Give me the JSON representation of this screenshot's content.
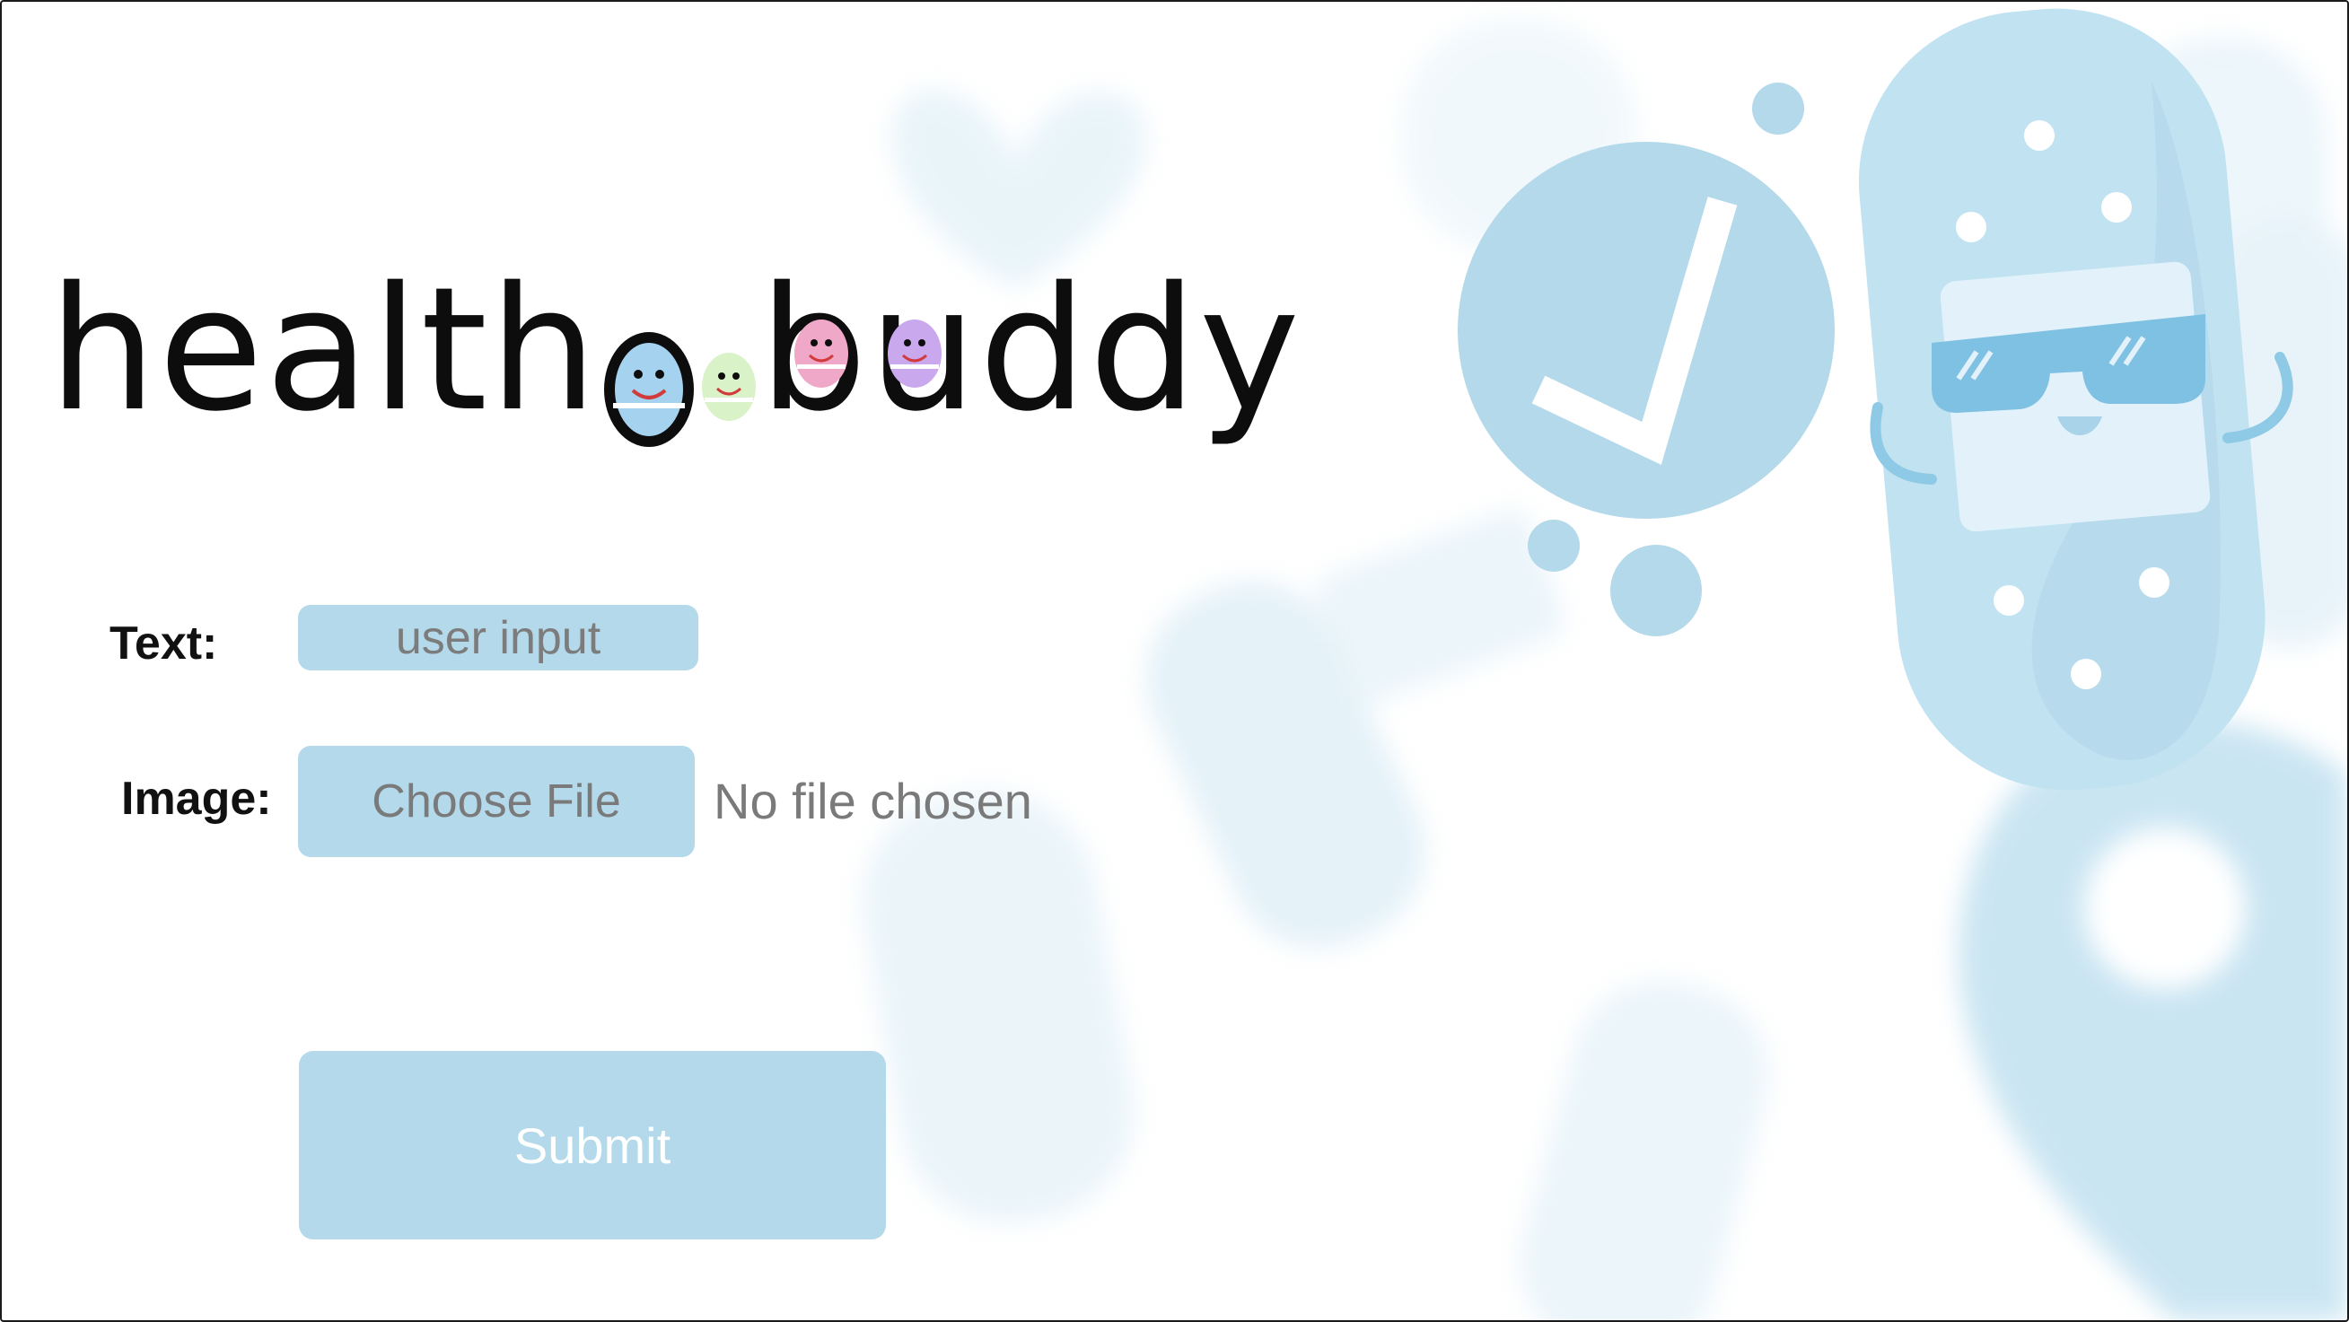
{
  "app": {
    "logo_text_left": "health",
    "logo_text_right": "buddy",
    "accent_color": "#b3d9ea"
  },
  "form": {
    "text_label": "Text:",
    "text_placeholder": "user input",
    "image_label": "Image:",
    "file_button_label": "Choose File",
    "file_status": "No file chosen",
    "submit_label": "Submit"
  },
  "decor": {
    "icons": [
      "checkmark-bubble-icon",
      "bandage-mascot-icon",
      "map-pin-icon",
      "calendar-icon",
      "heart-icon"
    ]
  }
}
